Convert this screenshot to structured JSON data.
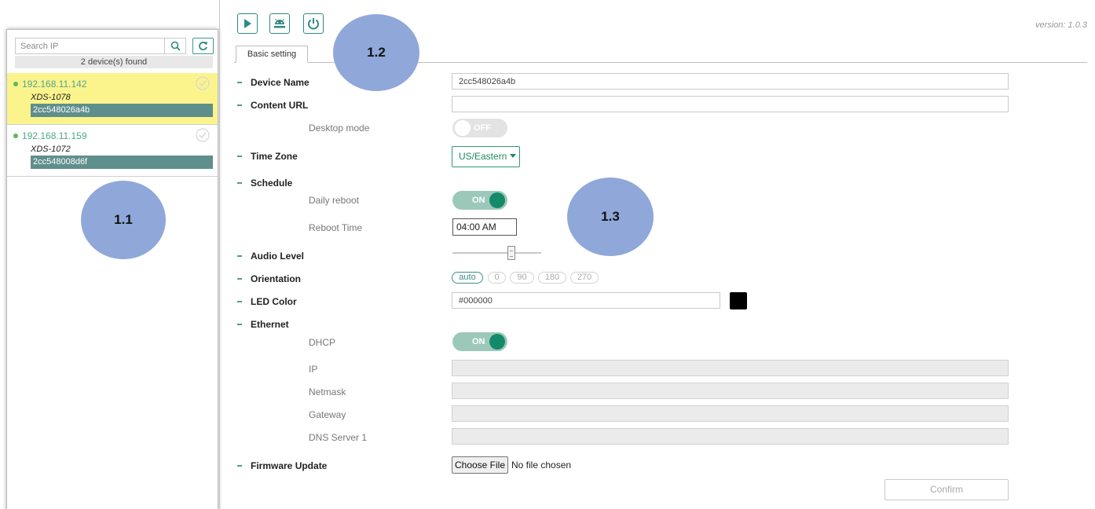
{
  "sidebar": {
    "search_placeholder": "Search IP",
    "device_count": "2 device(s) found",
    "devices": [
      {
        "ip": "192.168.11.142",
        "model": "XDS-1078",
        "id": "2cc548026a4b",
        "selected": true
      },
      {
        "ip": "192.168.11.159",
        "model": "XDS-1072",
        "id": "2cc548008d6f",
        "selected": false
      }
    ]
  },
  "callouts": {
    "c1": "1.1",
    "c2": "1.2",
    "c3": "1.3"
  },
  "header": {
    "version": "version: 1.0.3",
    "icons": [
      "play-icon",
      "android-icon",
      "power-icon"
    ]
  },
  "tabs": {
    "basic": "Basic setting"
  },
  "form": {
    "device_name": {
      "label": "Device Name",
      "value": "2cc548026a4b"
    },
    "content_url": {
      "label": "Content URL",
      "value": ""
    },
    "desktop_mode": {
      "label": "Desktop mode",
      "state": "OFF"
    },
    "time_zone": {
      "label": "Time Zone",
      "value": "US/Eastern"
    },
    "schedule": {
      "label": "Schedule"
    },
    "daily_reboot": {
      "label": "Daily reboot",
      "state": "ON"
    },
    "reboot_time": {
      "label": "Reboot Time",
      "value": "04:00 AM"
    },
    "audio_level": {
      "label": "Audio Level",
      "level_fraction": 0.66
    },
    "orientation": {
      "label": "Orientation",
      "options": [
        "auto",
        "0",
        "90",
        "180",
        "270"
      ],
      "selected": "auto"
    },
    "led_color": {
      "label": "LED Color",
      "value": "#000000",
      "swatch": "#000000"
    },
    "ethernet": {
      "label": "Ethernet"
    },
    "dhcp": {
      "label": "DHCP",
      "state": "ON"
    },
    "ip": {
      "label": "IP",
      "value": ""
    },
    "netmask": {
      "label": "Netmask",
      "value": ""
    },
    "gateway": {
      "label": "Gateway",
      "value": ""
    },
    "dns1": {
      "label": "DNS Server 1",
      "value": ""
    },
    "firmware": {
      "label": "Firmware Update",
      "button": "Choose File",
      "status": "No file chosen"
    },
    "confirm": "Confirm"
  },
  "colors": {
    "accent": "#2f8a82",
    "toggle_on": "#138a69",
    "selected_row": "#fbf48c",
    "device_id_bg": "#5f8f8c",
    "callout": "#8fa8d9"
  }
}
